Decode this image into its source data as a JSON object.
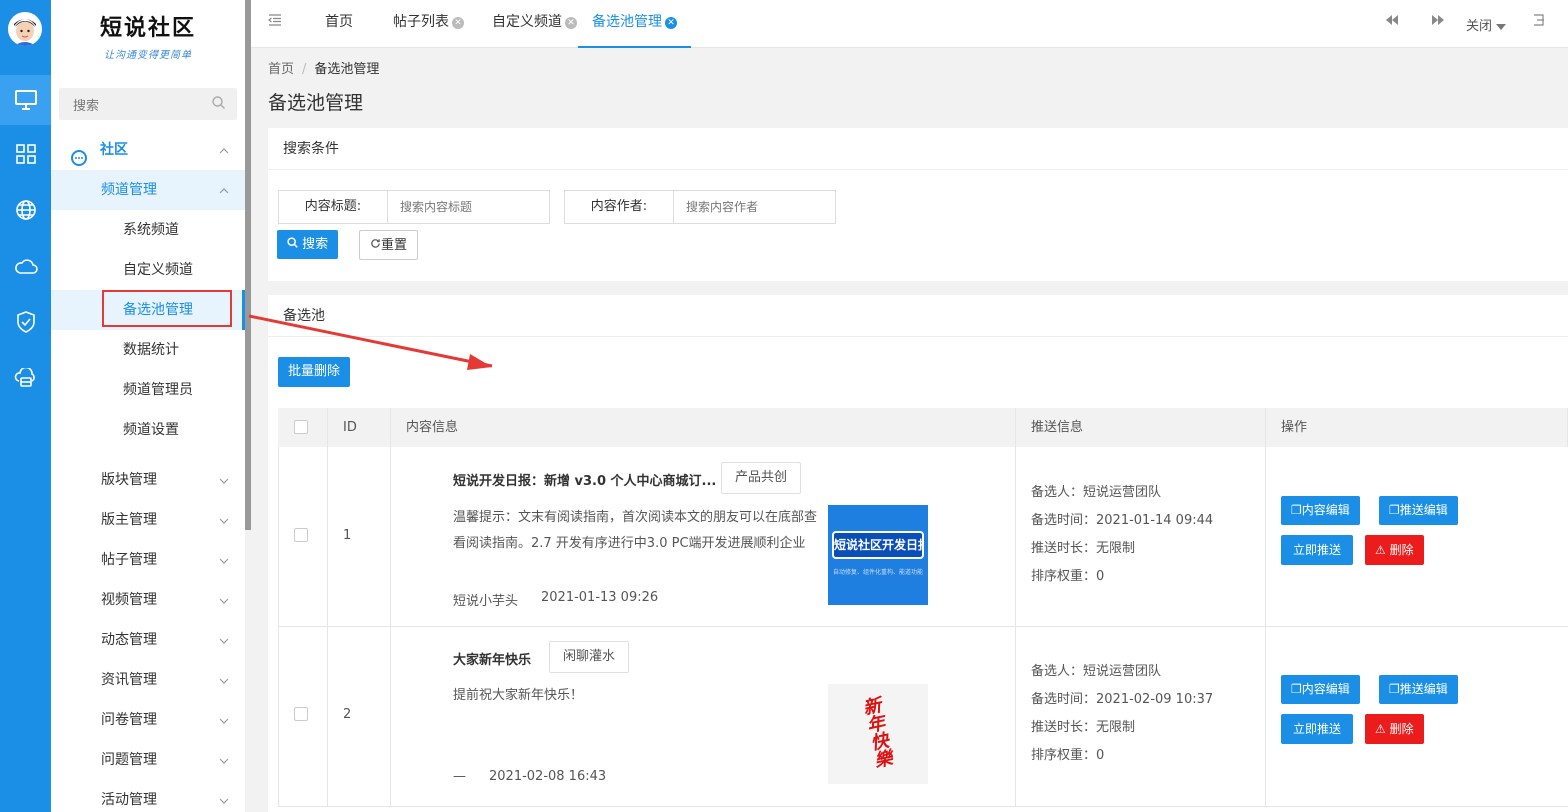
{
  "app": {
    "logo_title": "短说社区",
    "logo_slogan": "让沟通变得更简单"
  },
  "search": {
    "placeholder": "搜索"
  },
  "menu": {
    "community": "社区",
    "channel_mgmt": "频道管理",
    "leaves": [
      "系统频道",
      "自定义频道",
      "备选池管理",
      "数据统计",
      "频道管理员",
      "频道设置"
    ],
    "groups": [
      "版块管理",
      "版主管理",
      "帖子管理",
      "视频管理",
      "动态管理",
      "资讯管理",
      "问卷管理",
      "问题管理",
      "活动管理"
    ]
  },
  "tabs": [
    {
      "label": "首页"
    },
    {
      "label": "帖子列表"
    },
    {
      "label": "自定义频道"
    },
    {
      "label": "备选池管理"
    }
  ],
  "topright": {
    "close": "关闭"
  },
  "breadcrumb": {
    "home": "首页",
    "sep": "/",
    "current": "备选池管理"
  },
  "page_title": "备选池管理",
  "filter": {
    "header": "搜索条件",
    "title_label": "内容标题:",
    "title_placeholder": "搜索内容标题",
    "author_label": "内容作者:",
    "author_placeholder": "搜索内容作者",
    "search_btn": "搜索",
    "reset_btn": "重置"
  },
  "pool": {
    "header": "备选池",
    "batch_delete": "批量删除",
    "columns": [
      "ID",
      "内容信息",
      "推送信息",
      "操作"
    ],
    "actions": {
      "edit_content": "内容编辑",
      "edit_push": "推送编辑",
      "push_now": "立即推送",
      "delete": "删除"
    },
    "rows": [
      {
        "id": "1",
        "title": "短说开发日报：新增 v3.0 个人中心商城订...",
        "tag": "产品共创",
        "desc": "温馨提示：文末有阅读指南，首次阅读本文的朋友可以在底部查看阅读指南。2.7 开发有序进行中3.0 PC端开发进展顺利企业",
        "author": "短说小芋头",
        "date": "2021-01-13 09:26",
        "thumb_text": "短说社区开发日报",
        "thumb_sub": "自动修复、组件化重构、能道功能",
        "picker": "备选人：短说运营团队",
        "pick_time": "备选时间：2021-01-14 09:44",
        "duration": "推送时长：无限制",
        "weight": "排序权重：0"
      },
      {
        "id": "2",
        "title": "大家新年快乐",
        "tag": "闲聊灌水",
        "desc": "提前祝大家新年快乐！",
        "author": "—",
        "date": "2021-02-08 16:43",
        "thumb_text": "新年快樂",
        "thumb_sub": "",
        "picker": "备选人：短说运营团队",
        "pick_time": "备选时间：2021-02-09 10:37",
        "duration": "推送时长：无限制",
        "weight": "排序权重：0"
      }
    ]
  },
  "colors": {
    "primary": "#1b8fe6",
    "danger": "#ec1c1c",
    "annotation": "#e53935"
  }
}
